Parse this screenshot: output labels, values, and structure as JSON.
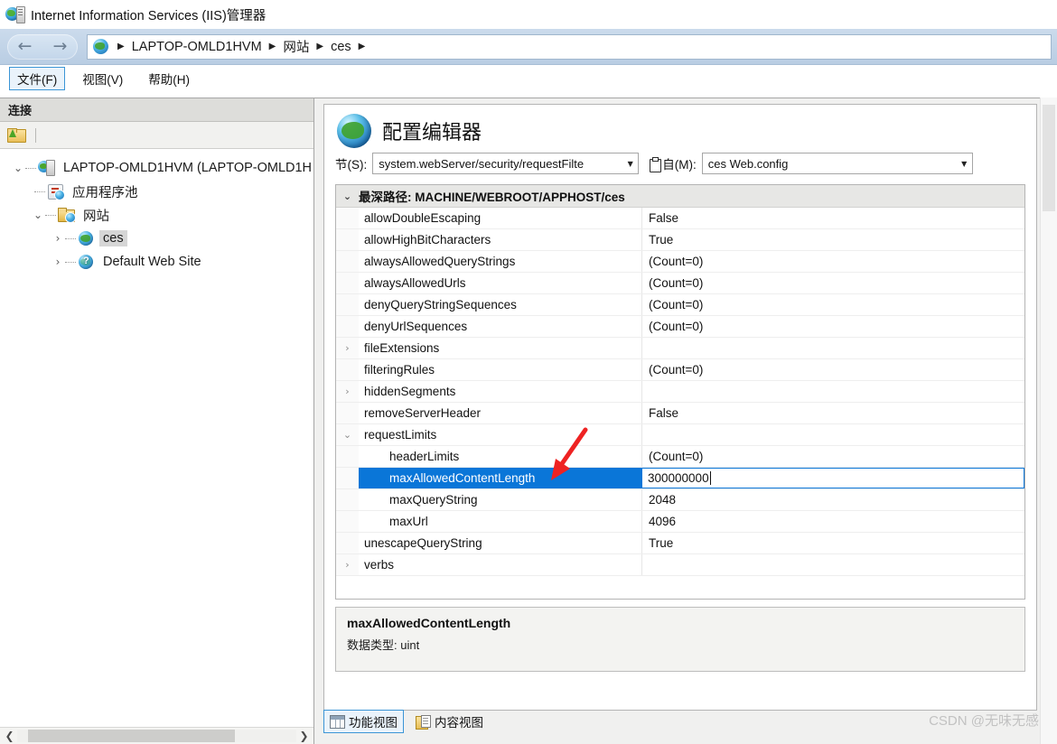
{
  "window": {
    "title": "Internet Information Services (IIS)管理器",
    "icon": "iis-server-globe-icon"
  },
  "address_bar": {
    "back_icon": "arrow-left-icon",
    "forward_icon": "arrow-right-icon",
    "root_icon": "globe-icon",
    "separator": "▶",
    "breadcrumbs": [
      "LAPTOP-OMLD1HVM",
      "网站",
      "ces"
    ]
  },
  "menu": {
    "items": [
      {
        "label": "文件(F)",
        "active": true
      },
      {
        "label": "视图(V)",
        "active": false
      },
      {
        "label": "帮助(H)",
        "active": false
      }
    ]
  },
  "connections_pane": {
    "header": "连接",
    "toolbar": {
      "connect_icon": "folder-green-arrow-icon"
    },
    "tree": [
      {
        "label": "LAPTOP-OMLD1HVM (LAPTOP-OMLD1H",
        "icon": "server-icon",
        "chevron": "⌄",
        "depth": 0,
        "selected": false
      },
      {
        "label": "应用程序池",
        "icon": "app-pool-icon",
        "chevron": "",
        "depth": 1,
        "selected": false
      },
      {
        "label": "网站",
        "icon": "sites-folder-icon",
        "chevron": "⌄",
        "depth": 1,
        "selected": false
      },
      {
        "label": "ces",
        "icon": "website-icon",
        "chevron": "›",
        "depth": 2,
        "selected": true
      },
      {
        "label": "Default Web Site",
        "icon": "website-stopped-icon",
        "chevron": "›",
        "depth": 2,
        "selected": false
      }
    ],
    "hscroll": {
      "left_icon": "chevron-left-icon",
      "right_icon": "chevron-right-icon"
    }
  },
  "config_editor": {
    "icon": "globe-icon",
    "title": "配置编辑器",
    "section": {
      "label": "节(S):",
      "value": "system.webServer/security/requestFilte",
      "caret": "▼"
    },
    "from": {
      "label": "自(M):",
      "icon": "document-icon",
      "value": "ces Web.config",
      "caret": "▼"
    },
    "grid": {
      "group_header": "最深路径: MACHINE/WEBROOT/APPHOST/ces",
      "group_chevron": "⌄",
      "rows": [
        {
          "name": "allowDoubleEscaping",
          "value": "False",
          "twisty": "",
          "indent": false,
          "selected": false
        },
        {
          "name": "allowHighBitCharacters",
          "value": "True",
          "twisty": "",
          "indent": false,
          "selected": false
        },
        {
          "name": "alwaysAllowedQueryStrings",
          "value": "(Count=0)",
          "twisty": "",
          "indent": false,
          "selected": false
        },
        {
          "name": "alwaysAllowedUrls",
          "value": "(Count=0)",
          "twisty": "",
          "indent": false,
          "selected": false
        },
        {
          "name": "denyQueryStringSequences",
          "value": "(Count=0)",
          "twisty": "",
          "indent": false,
          "selected": false
        },
        {
          "name": "denyUrlSequences",
          "value": "(Count=0)",
          "twisty": "",
          "indent": false,
          "selected": false
        },
        {
          "name": "fileExtensions",
          "value": "",
          "twisty": "›",
          "indent": false,
          "selected": false
        },
        {
          "name": "filteringRules",
          "value": "(Count=0)",
          "twisty": "",
          "indent": false,
          "selected": false
        },
        {
          "name": "hiddenSegments",
          "value": "",
          "twisty": "›",
          "indent": false,
          "selected": false
        },
        {
          "name": "removeServerHeader",
          "value": "False",
          "twisty": "",
          "indent": false,
          "selected": false
        },
        {
          "name": "requestLimits",
          "value": "",
          "twisty": "⌄",
          "indent": false,
          "selected": false
        },
        {
          "name": "headerLimits",
          "value": "(Count=0)",
          "twisty": "",
          "indent": true,
          "selected": false
        },
        {
          "name": "maxAllowedContentLength",
          "value": "300000000",
          "twisty": "",
          "indent": true,
          "selected": true
        },
        {
          "name": "maxQueryString",
          "value": "2048",
          "twisty": "",
          "indent": true,
          "selected": false
        },
        {
          "name": "maxUrl",
          "value": "4096",
          "twisty": "",
          "indent": true,
          "selected": false
        },
        {
          "name": "unescapeQueryString",
          "value": "True",
          "twisty": "",
          "indent": false,
          "selected": false
        },
        {
          "name": "verbs",
          "value": "",
          "twisty": "›",
          "indent": false,
          "selected": false
        }
      ]
    },
    "description": {
      "title": "maxAllowedContentLength",
      "datatype_label": "数据类型:",
      "datatype_value": "uint"
    }
  },
  "view_tabs": [
    {
      "label": "功能视图",
      "icon": "grid-view-icon",
      "active": true
    },
    {
      "label": "内容视图",
      "icon": "content-view-icon",
      "active": false
    }
  ],
  "watermark": "CSDN @无味无感",
  "annotation": {
    "type": "red-arrow",
    "color": "#ee2222",
    "points_to": "maxAllowedContentLength"
  },
  "colors": {
    "selection_blue": "#0a76d8",
    "address_bar": "#c2d4e8",
    "pane_header": "#ddddda",
    "annotation_red": "#ee2222"
  }
}
